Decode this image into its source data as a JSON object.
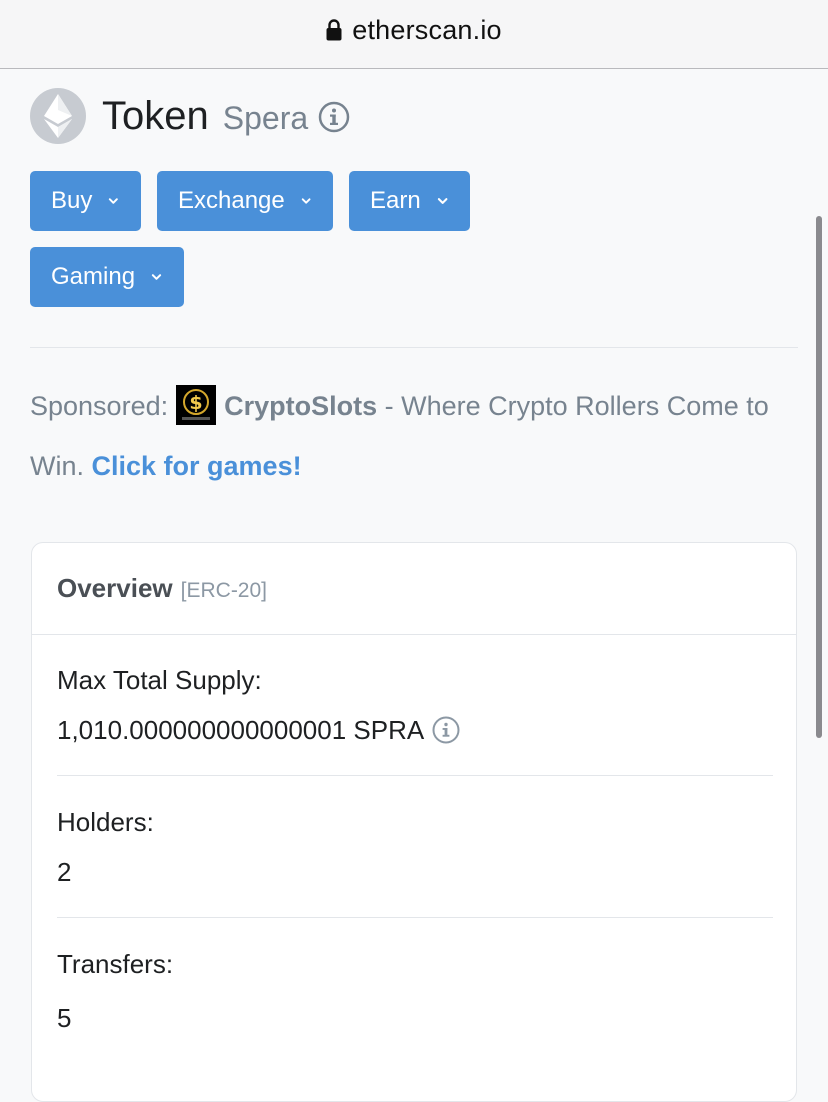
{
  "browser": {
    "url": "etherscan.io"
  },
  "token": {
    "title": "Token",
    "name": "Spera"
  },
  "actions": {
    "buy": "Buy",
    "exchange": "Exchange",
    "earn": "Earn",
    "gaming": "Gaming"
  },
  "sponsored": {
    "prefix": "Sponsored:",
    "name": "CryptoSlots",
    "tagline": " - Where Crypto Rollers Come to Win. ",
    "link": "Click for games!"
  },
  "overview": {
    "title": "Overview",
    "subtitle": "[ERC-20]",
    "max_supply_label": "Max Total Supply:",
    "max_supply_value": "1,010.000000000000001 SPRA",
    "holders_label": "Holders:",
    "holders_value": "2",
    "transfers_label": "Transfers:",
    "transfers_value": "5"
  },
  "colors": {
    "accent": "#4a90d9",
    "muted_text": "#77838f",
    "background": "#f8f9fa"
  },
  "icons": {
    "lock": "lock-icon",
    "eth": "ethereum-logo-icon",
    "info": "info-circle-icon",
    "chevron": "chevron-down-icon"
  }
}
